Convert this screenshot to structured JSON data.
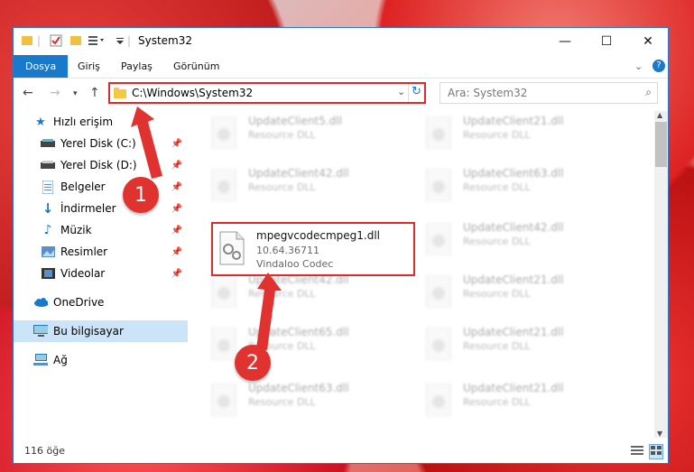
{
  "window": {
    "title": "System32",
    "controls": {
      "minimize": "—",
      "maximize": "☐",
      "close": "✕"
    }
  },
  "ribbon": {
    "tabs": [
      "Dosya",
      "Giriş",
      "Paylaş",
      "Görünüm"
    ]
  },
  "address_bar": {
    "path": "C:\\Windows\\System32"
  },
  "search": {
    "placeholder": "Ara: System32"
  },
  "sidebar": {
    "items": [
      {
        "label": "Hızlı erişim",
        "icon": "star-icon"
      },
      {
        "label": "Yerel Disk (C:)",
        "icon": "drive-icon"
      },
      {
        "label": "Yerel Disk (D:)",
        "icon": "drive-icon"
      },
      {
        "label": "Belgeler",
        "icon": "document-icon"
      },
      {
        "label": "İndirmeler",
        "icon": "download-icon"
      },
      {
        "label": "Müzik",
        "icon": "music-icon"
      },
      {
        "label": "Resimler",
        "icon": "pictures-icon"
      },
      {
        "label": "Videolar",
        "icon": "video-icon"
      },
      {
        "label": "OneDrive",
        "icon": "cloud-icon"
      },
      {
        "label": "Bu bilgisayar",
        "icon": "computer-icon"
      },
      {
        "label": "Ağ",
        "icon": "network-icon"
      }
    ]
  },
  "files": {
    "left": [
      {
        "name": "UpdateClient5.dll",
        "desc": "Resource DLL"
      },
      {
        "name": "UpdateClient42.dll",
        "desc": "Resource DLL"
      },
      {
        "name": "UpdateClient42.dll",
        "desc": "Resource DLL"
      },
      {
        "name": "UpdateClient65.dll",
        "desc": "Resource DLL"
      },
      {
        "name": "UpdateClient63.dll",
        "desc": "Resource DLL"
      }
    ],
    "right": [
      {
        "name": "UpdateClient21.dll",
        "desc": "Resource DLL"
      },
      {
        "name": "UpdateClient63.dll",
        "desc": "Resource DLL"
      },
      {
        "name": "UpdateClient42.dll",
        "desc": "Resource DLL"
      },
      {
        "name": "UpdateClient21.dll",
        "desc": "Resource DLL"
      },
      {
        "name": "UpdateClient21.dll",
        "desc": "Resource DLL"
      },
      {
        "name": "UpdateClient21.dll",
        "desc": "Resource DLL"
      }
    ],
    "selected": {
      "name": "mpegvcodecmpeg1.dll",
      "version": "10.64.36711",
      "desc": "Vindaloo Codec"
    }
  },
  "status": {
    "count": "116 öğe"
  },
  "annotations": {
    "step1": "1",
    "step2": "2"
  },
  "colors": {
    "accent": "#1979ca",
    "highlight": "#e02a2a"
  }
}
